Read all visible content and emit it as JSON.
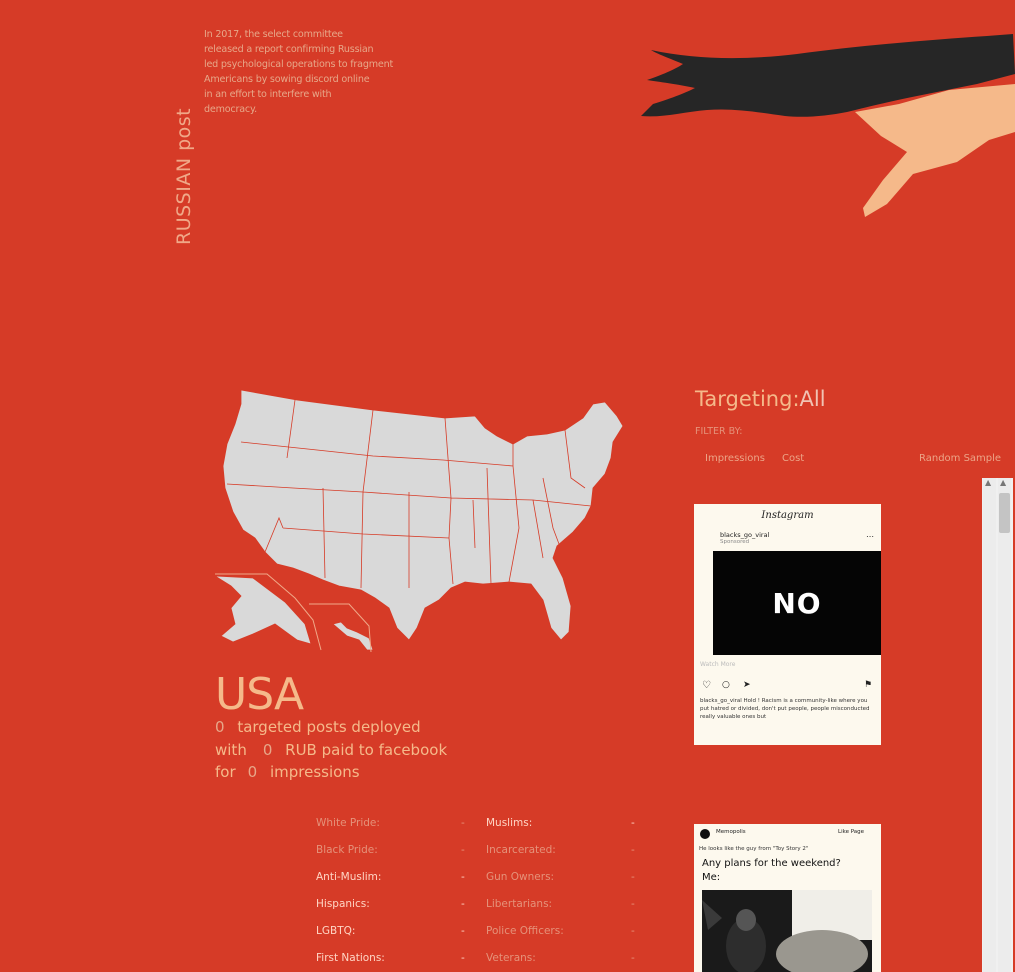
{
  "intro": {
    "lines": [
      "In 2017, the select committee",
      "released a report confirming Russian",
      "led psychological operations to fragment",
      "Americans by sowing discord online",
      "in an effort to interfere with",
      "democracy."
    ]
  },
  "vertical_title": "RUSSIAN post",
  "country": "USA",
  "stats": {
    "posts_count": "0",
    "posts_text": "targeted posts deployed",
    "with_text": "with",
    "rub_count": "0",
    "rub_text": "RUB paid to facebook",
    "for_text": "for",
    "impressions_count": "0",
    "impressions_text": "impressions"
  },
  "targets_left": [
    {
      "label": "White Pride:",
      "value": "-",
      "active": false
    },
    {
      "label": "Black Pride:",
      "value": "-",
      "active": false
    },
    {
      "label": "Anti-Muslim:",
      "value": "-",
      "active": true
    },
    {
      "label": "Hispanics:",
      "value": "-",
      "active": true
    },
    {
      "label": "LGBTQ:",
      "value": "-",
      "active": true
    },
    {
      "label": "First Nations:",
      "value": "-",
      "active": true
    }
  ],
  "targets_right": [
    {
      "label": "Muslims:",
      "value": "-",
      "active": true
    },
    {
      "label": "Incarcerated:",
      "value": "-",
      "active": false
    },
    {
      "label": "Gun Owners:",
      "value": "-",
      "active": false
    },
    {
      "label": "Libertarians:",
      "value": "-",
      "active": false
    },
    {
      "label": "Police Officers:",
      "value": "-",
      "active": false
    },
    {
      "label": "Veterans:",
      "value": "-",
      "active": false
    }
  ],
  "targeting": {
    "label": "Targeting:",
    "value": "All"
  },
  "filter_by": "FILTER BY:",
  "filters": {
    "impressions": "Impressions",
    "cost": "Cost",
    "random": "Random Sample"
  },
  "card1": {
    "app": "Instagram",
    "account": "blacks_go_viral",
    "sponsored": "Sponsored",
    "image_text": "NO",
    "watch": "Watch More",
    "caption": "blacks_go_viral Hold ! Racism is a community-like where you put hatred or divided, don't put people, people misconducted really valuable ones but"
  },
  "card2": {
    "account": "Memopolis",
    "like": "Like Page",
    "sub": "He looks like the guy from \"Toy Story 2\"",
    "text1": "Any plans for the weekend?",
    "text2": "Me:"
  },
  "colors": {
    "background": "#d63b27",
    "accent": "#f5b98a",
    "map": "#d9d9d9",
    "glove": "#262626",
    "skin": "#f5b98a"
  }
}
